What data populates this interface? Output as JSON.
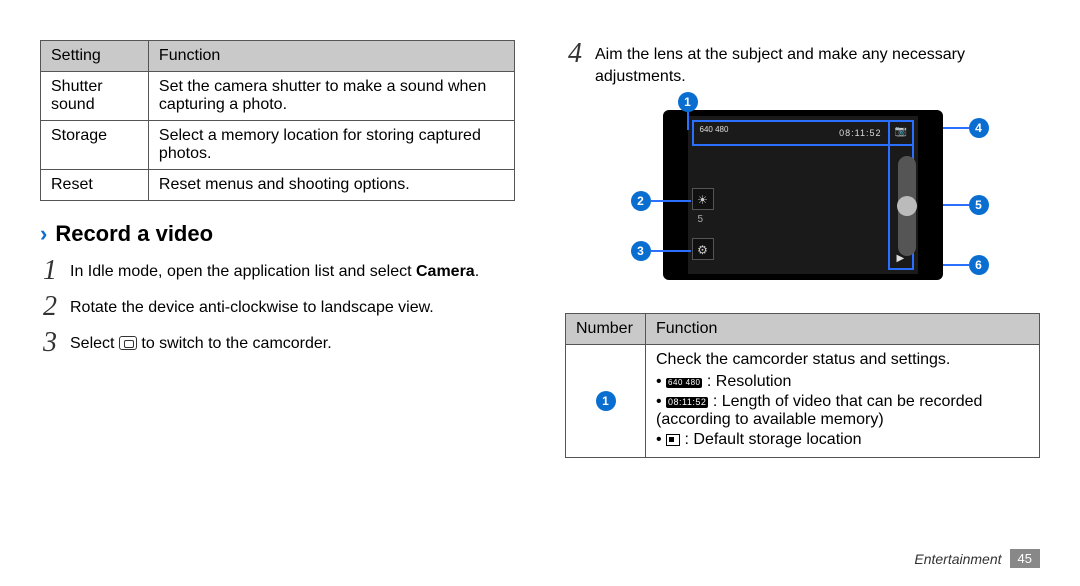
{
  "table1": {
    "head": {
      "setting": "Setting",
      "function": "Function"
    },
    "rows": [
      {
        "setting": "Shutter sound",
        "function": "Set the camera shutter to make a sound when capturing a photo."
      },
      {
        "setting": "Storage",
        "function": "Select a memory location for storing captured photos."
      },
      {
        "setting": "Reset",
        "function": "Reset menus and shooting options."
      }
    ]
  },
  "section": {
    "chevron": "›",
    "title": "Record a video"
  },
  "steps": {
    "s1": {
      "num": "1",
      "pre": "In Idle mode, open the application list and select ",
      "bold": "Camera",
      "post": "."
    },
    "s2": {
      "num": "2",
      "text": "Rotate the device anti-clockwise to landscape view."
    },
    "s3": {
      "num": "3",
      "pre": "Select ",
      "post": " to switch to the camcorder."
    },
    "s4": {
      "num": "4",
      "text": "Aim the lens at the subject and make any necessary adjustments."
    }
  },
  "diagram": {
    "badges": {
      "b1": "1",
      "b2": "2",
      "b3": "3",
      "b4": "4",
      "b5": "5",
      "b6": "6"
    },
    "topstrip": {
      "resol": "640\n480",
      "length": "08:11:52"
    },
    "icons": {
      "exposure": "☀",
      "settings_gear": "⚙",
      "camera_switch": "📷",
      "play": "▶"
    }
  },
  "table2": {
    "head": {
      "number": "Number",
      "function": "Function"
    },
    "row1": {
      "badge": "1",
      "intro": "Check the camcorder status and settings.",
      "li_res": " : Resolution",
      "li_len": " : Length of video that can be recorded (according to available memory)",
      "li_stor": " : Default storage location",
      "res_icon": "640 480",
      "len_icon": "08:11:52"
    }
  },
  "footer": {
    "category": "Entertainment",
    "page": "45"
  }
}
